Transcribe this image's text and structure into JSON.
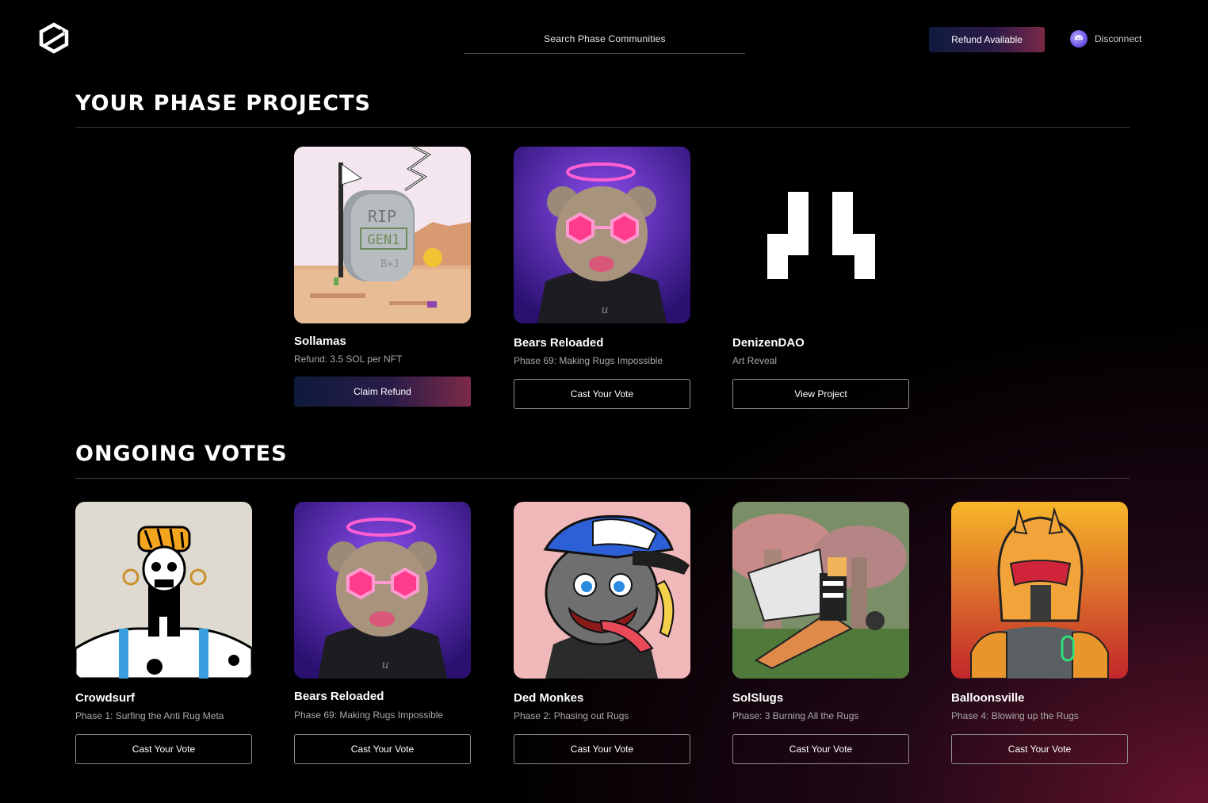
{
  "header": {
    "search_placeholder": "Search Phase Communities",
    "refund_label": "Refund Available",
    "disconnect_label": "Disconnect"
  },
  "projects": {
    "title": "YOUR PHASE PROJECTS",
    "cards": [
      {
        "name": "Sollamas",
        "subtitle": "Refund: 3.5 SOL per NFT",
        "button": "Claim Refund"
      },
      {
        "name": "Bears Reloaded",
        "subtitle": "Phase 69: Making Rugs Impossible",
        "button": "Cast Your Vote"
      },
      {
        "name": "DenizenDAO",
        "subtitle": "Art Reveal",
        "button": "View Project"
      }
    ]
  },
  "votes": {
    "title": "ONGOING VOTES",
    "cards": [
      {
        "name": "Crowdsurf",
        "subtitle": "Phase 1: Surfing the Anti Rug Meta",
        "button": "Cast Your Vote"
      },
      {
        "name": "Bears Reloaded",
        "subtitle": "Phase 69: Making Rugs Impossible",
        "button": "Cast Your Vote"
      },
      {
        "name": "Ded Monkes",
        "subtitle": "Phase 2: Phasing out Rugs",
        "button": "Cast Your Vote"
      },
      {
        "name": "SolSlugs",
        "subtitle": "Phase: 3 Burning All the Rugs",
        "button": "Cast Your Vote"
      },
      {
        "name": "Balloonsville",
        "subtitle": "Phase 4: Blowing up the Rugs",
        "button": "Cast Your Vote"
      }
    ]
  },
  "artwork_text": {
    "tombstone_line1": "RIP",
    "tombstone_line2": "GEN1",
    "tombstone_line3": "B+J"
  }
}
